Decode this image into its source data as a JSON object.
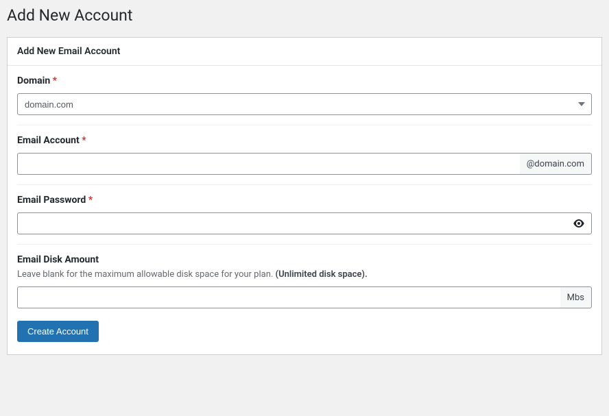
{
  "page": {
    "title": "Add New Account"
  },
  "panel": {
    "header": "Add New Email Account"
  },
  "form": {
    "domain": {
      "label": "Domain",
      "required_mark": "*",
      "value": "domain.com"
    },
    "email_account": {
      "label": "Email Account",
      "required_mark": "*",
      "value": "",
      "suffix": "@domain.com"
    },
    "email_password": {
      "label": "Email Password",
      "required_mark": "*",
      "value": ""
    },
    "disk": {
      "label": "Email Disk Amount",
      "helper_prefix": "Leave blank for the maximum allowable disk space for your plan. ",
      "helper_strong": "(Unlimited disk space).",
      "value": "",
      "suffix": "Mbs"
    },
    "submit_label": "Create Account"
  },
  "icons": {
    "caret_down": "chevron-down-icon",
    "eye": "eye-icon"
  }
}
